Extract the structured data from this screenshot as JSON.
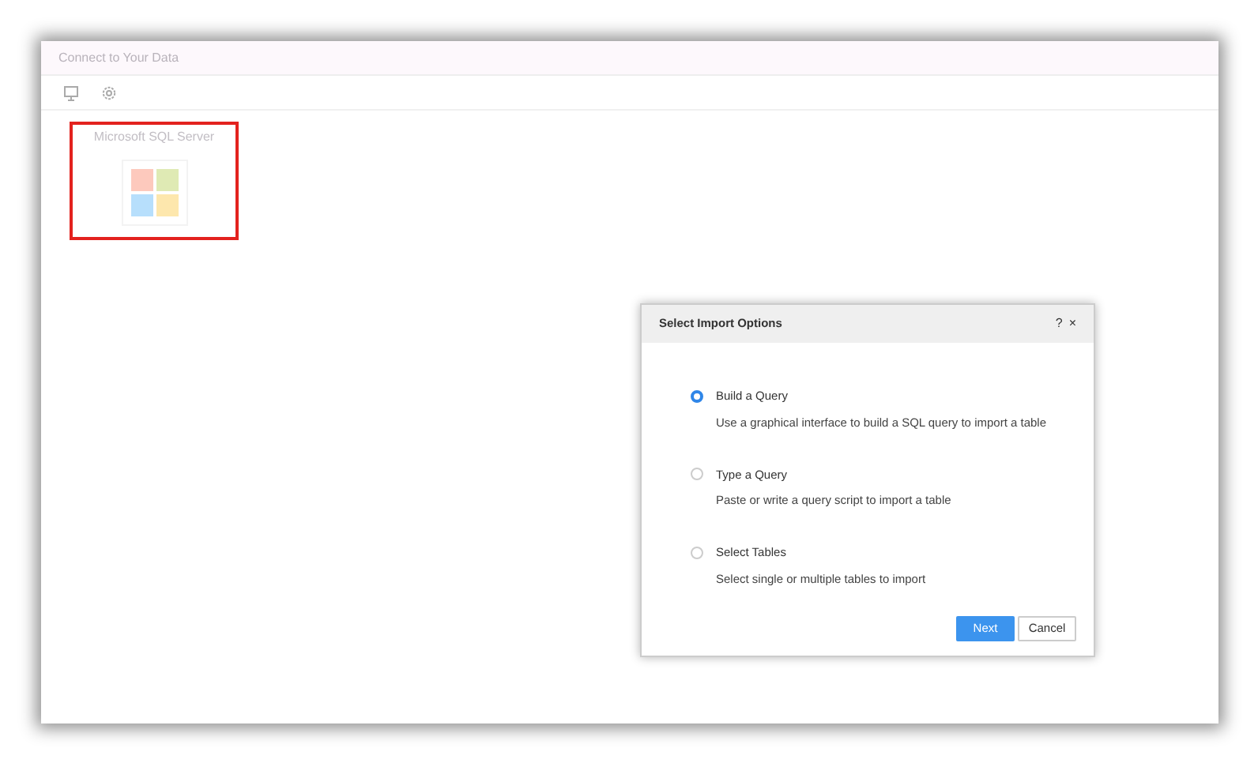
{
  "window": {
    "title": "Connect to Your Data"
  },
  "toolbar": {
    "icons": [
      {
        "kind": "monitor"
      },
      {
        "kind": "settings"
      }
    ]
  },
  "sources": [
    {
      "label": "Microsoft SQL Server",
      "selected": true
    }
  ],
  "dialog": {
    "title": "Select Import Options",
    "help": "?",
    "close": "×",
    "options": [
      {
        "label": "Build a Query",
        "description": "Use a graphical interface to build a SQL query to import a table",
        "selected": true
      },
      {
        "label": "Type a Query",
        "description": "Paste or write a query script to import a table",
        "selected": false
      },
      {
        "label": "Select Tables",
        "description": "Select single or multiple tables to import",
        "selected": false
      }
    ],
    "buttons": [
      {
        "label": "Next",
        "kind": "primary"
      },
      {
        "label": "Cancel",
        "kind": "secondary"
      }
    ]
  }
}
